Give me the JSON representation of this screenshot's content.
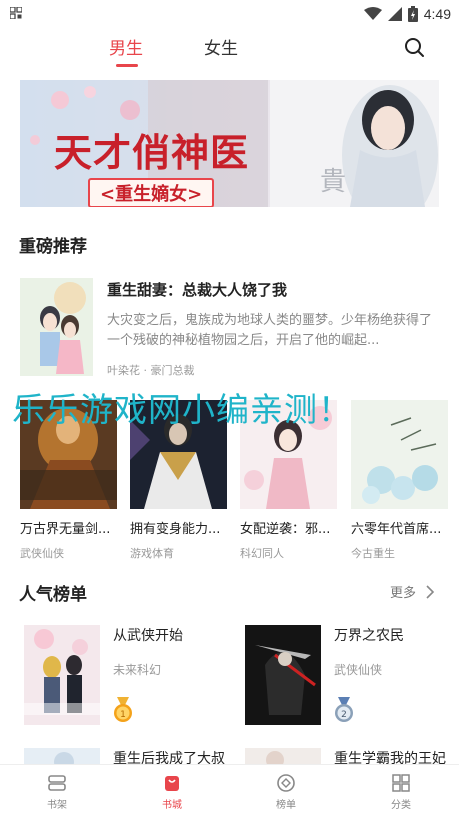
{
  "status_bar": {
    "time": "4:49"
  },
  "tabs": [
    {
      "label": "男生",
      "active": true
    },
    {
      "label": "女生",
      "active": false
    }
  ],
  "banner": {
    "title": "天才俏神医",
    "subtitle": "<重生嫡女>"
  },
  "featured": {
    "section_title": "重磅推荐",
    "book": {
      "title": "重生甜妻：总裁大人饶了我",
      "description": "大灾变之后，鬼族成为地球人类的噩梦。少年杨绝获得了一个残破的神秘植物园之后，开启了他的崛起...",
      "author": "叶染花",
      "category": "豪门总裁"
    }
  },
  "watermark": "乐乐游戏网小编亲测！",
  "grid_books": [
    {
      "title": "万古界无量剑...",
      "category": "武侠仙侠",
      "cover_text": "萬古界無量劍尊"
    },
    {
      "title": "拥有变身能力...",
      "category": "游戏体育"
    },
    {
      "title": "女配逆袭：邪...",
      "category": "科幻同人"
    },
    {
      "title": "六零年代首席...",
      "category": "今古重生"
    }
  ],
  "popular": {
    "section_title": "人气榜单",
    "more_label": "更多",
    "items": [
      {
        "title": "从武侠开始",
        "category": "未来科幻",
        "rank": "1",
        "cover_text": "從武俠開始"
      },
      {
        "title": "万界之农民",
        "category": "武侠仙侠",
        "rank": "2",
        "cover_text": "万界之农民"
      },
      {
        "title": "重生后我成了大叔"
      },
      {
        "title": "重生学霸我的王妃"
      }
    ]
  },
  "bottom_nav": [
    {
      "label": "书架",
      "icon": "bookshelf-icon",
      "active": false
    },
    {
      "label": "书城",
      "icon": "bookstore-icon",
      "active": true
    },
    {
      "label": "榜单",
      "icon": "ranking-icon",
      "active": false
    },
    {
      "label": "分类",
      "icon": "category-icon",
      "active": false
    }
  ],
  "colors": {
    "accent": "#e8454b",
    "watermark": "#1fb4c9",
    "medal_gold": "#f4a21a",
    "medal_silver": "#8aa0b8"
  }
}
